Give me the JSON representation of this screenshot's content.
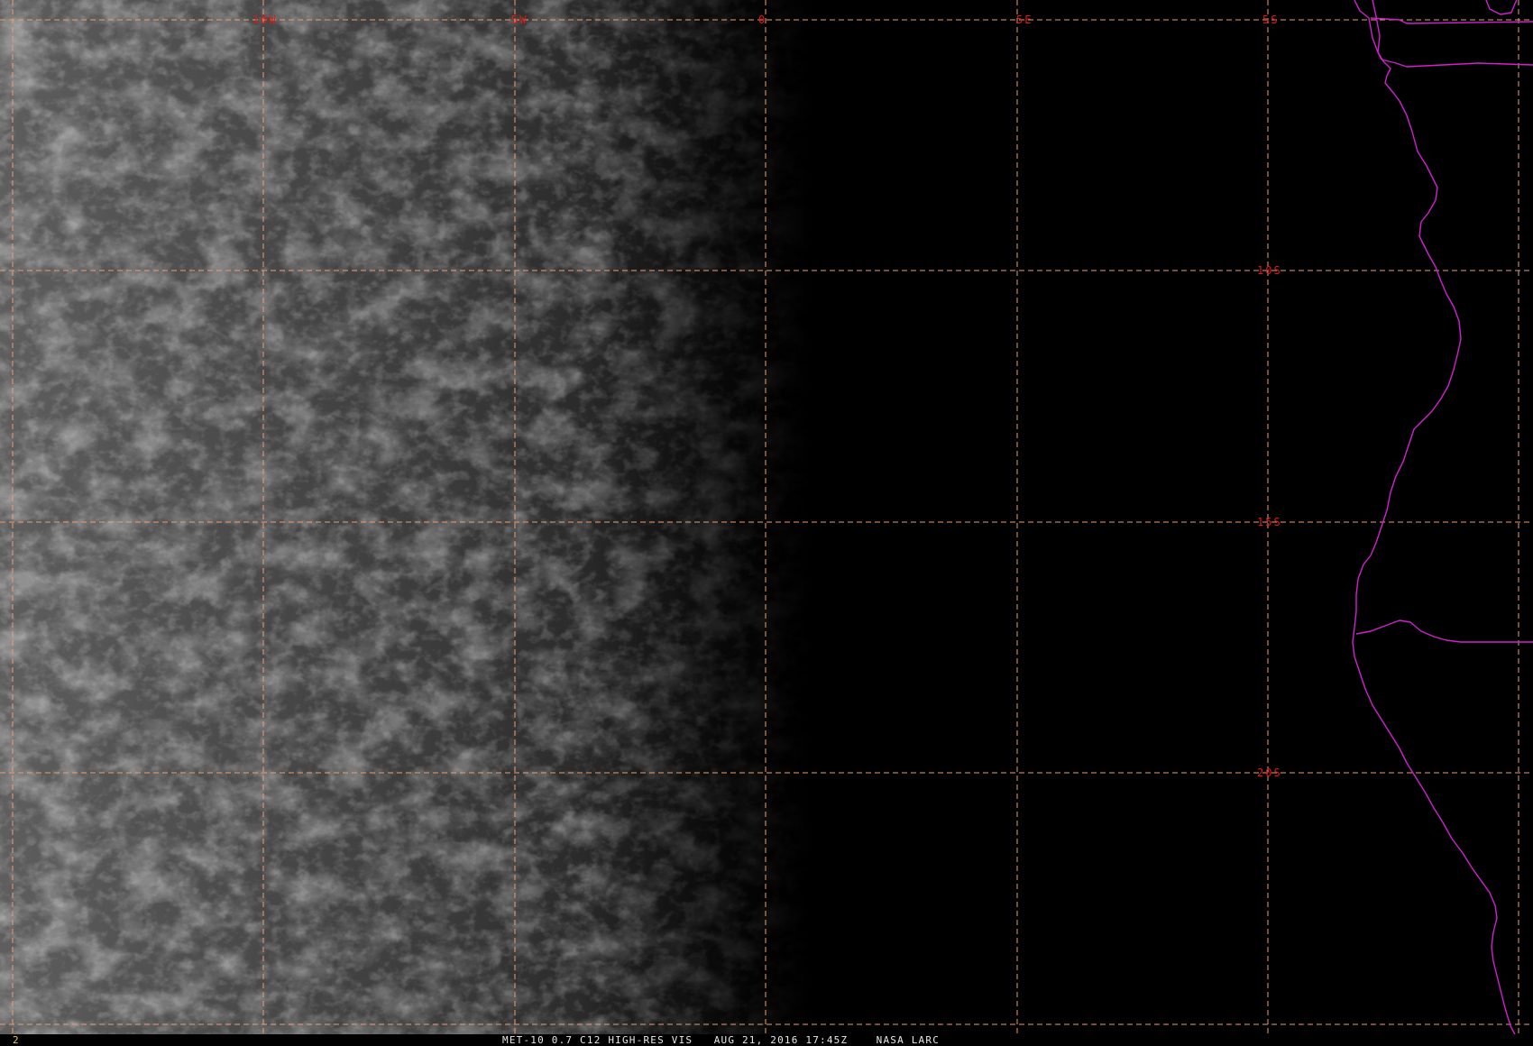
{
  "colors": {
    "gridline": "#e8a070",
    "grid_label": "#e01818",
    "coastline": "#d020d0",
    "caption": "#e8e8e8",
    "frame_number": "#e8d040"
  },
  "map": {
    "longitude_labels": [
      "10W",
      "5W",
      "0",
      "5E"
    ],
    "latitude_labels": [
      "5S",
      "10S",
      "15S",
      "20S"
    ]
  },
  "status_bar": {
    "frame_number": "2",
    "product": "MET-10 0.7 C12 HIGH-RES VIS",
    "datetime": "AUG 21, 2016 17:45Z",
    "source": "NASA LARC"
  }
}
